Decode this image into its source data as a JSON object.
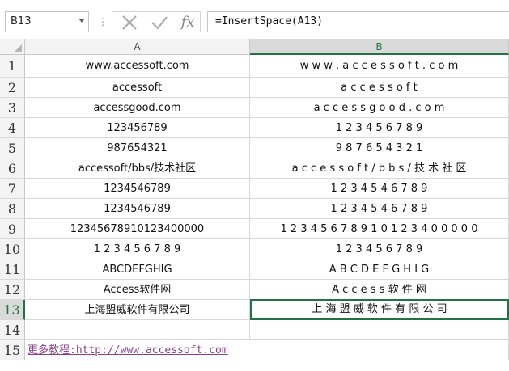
{
  "formula_bar": {
    "name_box": "B13",
    "separator": "⋮",
    "fx_label": "fx",
    "formula": "=InsertSpace(A13)"
  },
  "columns": [
    "A",
    "B"
  ],
  "rows": [
    {
      "num": "1",
      "a": "www.accessoft.com",
      "b": "w w w . a c c e s s o f t . c o m"
    },
    {
      "num": "2",
      "a": "accessoft",
      "b": "a c c e s s o f t"
    },
    {
      "num": "3",
      "a": "accessgood.com",
      "b": "a c c e s s g o o d . c o m"
    },
    {
      "num": "4",
      "a": "123456789",
      "b": "1 2 3 4 5 6 7 8 9"
    },
    {
      "num": "5",
      "a": "987654321",
      "b": "9 8 7 6 5 4 3 2 1"
    },
    {
      "num": "6",
      "a": "accessoft/bbs/技术社区",
      "b": "a c c e s s o f t / b b s / 技 术 社 区"
    },
    {
      "num": "7",
      "a": "1234546789",
      "b": "1 2 3 4 5 4 6 7 8 9"
    },
    {
      "num": "8",
      "a": "1234546789",
      "b": "1 2 3 4 5 4 6 7 8 9"
    },
    {
      "num": "9",
      "a": "12345678910123400000",
      "b": "1 2 3 4 5 6 7 8 9 1 0 1 2 3 4 0 0 0 0 0"
    },
    {
      "num": "10",
      "a": "1 2 3 4 5 6 7 8 9",
      "b": "1   2   3   4   5   6   7   8   9"
    },
    {
      "num": "11",
      "a": "ABCDEFGHIG",
      "b": "A B C D E F G H I G"
    },
    {
      "num": "12",
      "a": "Access软件网",
      "b": "A c c e s s 软 件 网"
    },
    {
      "num": "13",
      "a": "上海盟威软件有限公司",
      "b": "上 海 盟 威 软 件 有 限 公 司"
    },
    {
      "num": "14",
      "a": "",
      "b": ""
    },
    {
      "num": "15",
      "a": "更多教程:http://www.accessoft.com",
      "b": ""
    }
  ],
  "active_cell": "B13",
  "colors": {
    "accent": "#217346",
    "link": "#8a3f8a"
  }
}
